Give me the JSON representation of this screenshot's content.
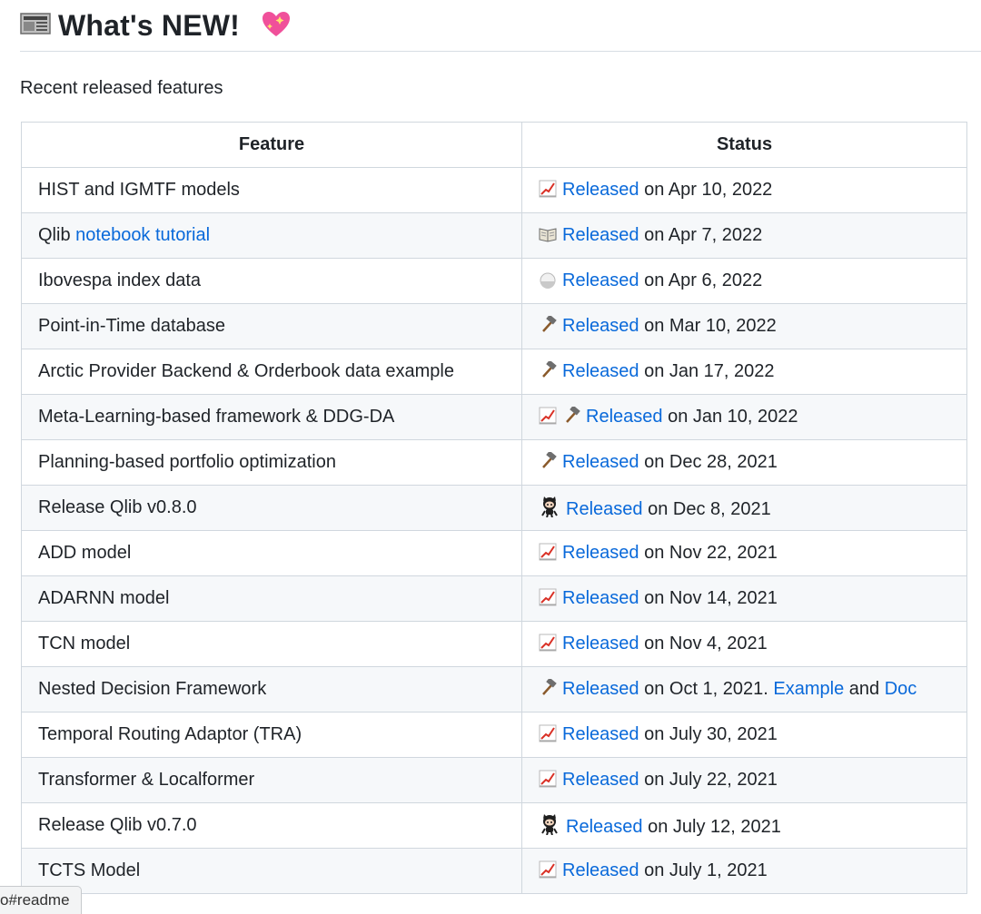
{
  "header": {
    "title": "What's NEW!",
    "title_icon": "newspaper-icon",
    "trailing_icon": "sparkling-heart-icon"
  },
  "intro": "Recent released features",
  "table": {
    "headers": [
      "Feature",
      "Status"
    ],
    "rows": [
      {
        "feature": "HIST and IGMTF models",
        "icons": [
          "chart-icon"
        ],
        "link": "Released",
        "rest": "on Apr 10, 2022"
      },
      {
        "feature_prefix": "Qlib",
        "feature_link": "notebook tutorial",
        "icons": [
          "book-icon"
        ],
        "link": "Released",
        "rest": "on Apr 7, 2022"
      },
      {
        "feature": "Ibovespa index data",
        "icons": [
          "rice-ball-icon"
        ],
        "link": "Released",
        "rest": "on Apr 6, 2022"
      },
      {
        "feature": "Point-in-Time database",
        "icons": [
          "hammer-icon"
        ],
        "link": "Released",
        "rest": "on Mar 10, 2022"
      },
      {
        "feature": "Arctic Provider Backend & Orderbook data example",
        "icons": [
          "hammer-icon"
        ],
        "link": "Released",
        "rest": "on Jan 17, 2022"
      },
      {
        "feature": "Meta-Learning-based framework & DDG-DA",
        "icons": [
          "chart-icon",
          "hammer-icon"
        ],
        "link": "Released",
        "rest": "on Jan 10, 2022"
      },
      {
        "feature": "Planning-based portfolio optimization",
        "icons": [
          "hammer-icon"
        ],
        "link": "Released",
        "rest": "on Dec 28, 2021"
      },
      {
        "feature": "Release Qlib v0.8.0",
        "icons": [
          "octocat-icon"
        ],
        "link": "Released",
        "rest": "on Dec 8, 2021"
      },
      {
        "feature": "ADD model",
        "icons": [
          "chart-icon"
        ],
        "link": "Released",
        "rest": "on Nov 22, 2021"
      },
      {
        "feature": "ADARNN model",
        "icons": [
          "chart-icon"
        ],
        "link": "Released",
        "rest": "on Nov 14, 2021"
      },
      {
        "feature": "TCN model",
        "icons": [
          "chart-icon"
        ],
        "link": "Released",
        "rest": "on Nov 4, 2021"
      },
      {
        "feature": "Nested Decision Framework",
        "icons": [
          "hammer-icon"
        ],
        "link": "Released",
        "rest": "on Oct 1, 2021.",
        "extra_link_1": "Example",
        "extra_text": "and",
        "extra_link_2": "Doc"
      },
      {
        "feature": "Temporal Routing Adaptor (TRA)",
        "icons": [
          "chart-icon"
        ],
        "link": "Released",
        "rest": "on July 30, 2021"
      },
      {
        "feature": "Transformer & Localformer",
        "icons": [
          "chart-icon"
        ],
        "link": "Released",
        "rest": "on July 22, 2021"
      },
      {
        "feature": "Release Qlib v0.7.0",
        "icons": [
          "octocat-icon"
        ],
        "link": "Released",
        "rest": "on July 12, 2021"
      },
      {
        "feature": "TCTS Model",
        "icons": [
          "chart-icon"
        ],
        "link": "Released",
        "rest": "on July 1, 2021"
      }
    ]
  },
  "statusbar": {
    "url_text": "o#readme"
  },
  "colors": {
    "link": "#0969da",
    "border": "#d0d7de",
    "stripe": "#f6f8fa"
  }
}
